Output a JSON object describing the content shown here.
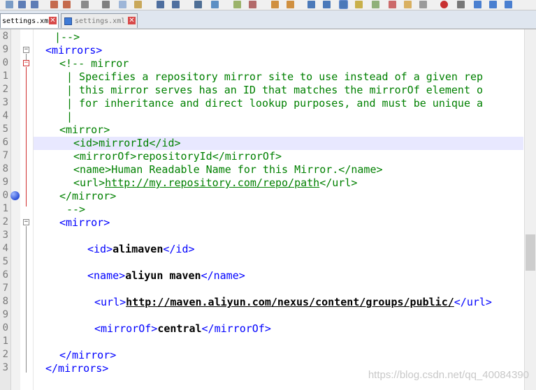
{
  "tabs": [
    {
      "label": "settings.xml",
      "active": true
    },
    {
      "label": "settings.xml",
      "active": false
    }
  ],
  "line_numbers": [
    "8",
    "9",
    "0",
    "1",
    "2",
    "3",
    "4",
    "5",
    "6",
    "7",
    "8",
    "9",
    "0",
    "1",
    "2",
    "3",
    "4",
    "5",
    "6",
    "7",
    "8",
    "9",
    "0",
    "1",
    "2",
    "3"
  ],
  "code": {
    "l8": "|-->",
    "l9_tag": "<mirrors>",
    "l10": "<!-- mirror",
    "l11": "| Specifies a repository mirror site to use instead of a given rep",
    "l12": "| this mirror serves has an ID that matches the mirrorOf element o",
    "l13": "| for inheritance and direct lookup purposes, and must be unique a",
    "l14": "|",
    "l15_tag": "<mirror>",
    "l16_open": "<id>",
    "l16_text": "mirrorId",
    "l16_close": "</id>",
    "l17_open": "<mirrorOf>",
    "l17_text": "repositoryId",
    "l17_close": "</mirrorOf>",
    "l18_open": "<name>",
    "l18_text": "Human Readable Name for this Mirror.",
    "l18_close": "</name>",
    "l19_open": "<url>",
    "l19_text": "http://my.repository.com/repo/path",
    "l19_close": "</url>",
    "l20_tag": "</mirror>",
    "l21": "-->",
    "l22_tag": "<mirror>",
    "l24_open": "<id>",
    "l24_text": "alimaven",
    "l24_close": "</id>",
    "l26_open": "<name>",
    "l26_text": "aliyun maven",
    "l26_close": "</name>",
    "l28_open": "<url>",
    "l28_text": "http://maven.aliyun.com/nexus/content/groups/public/",
    "l28_close": "</url>",
    "l30_open": "<mirrorOf>",
    "l30_text": "central",
    "l30_close": "</mirrorOf>",
    "l32_tag": "</mirror>",
    "l33_tag": "</mirrors>"
  },
  "watermark": "https://blog.csdn.net/qq_40084390",
  "colors": {
    "tag": "#0000ff",
    "comment": "#008000",
    "highlight": "#e8e8ff"
  }
}
